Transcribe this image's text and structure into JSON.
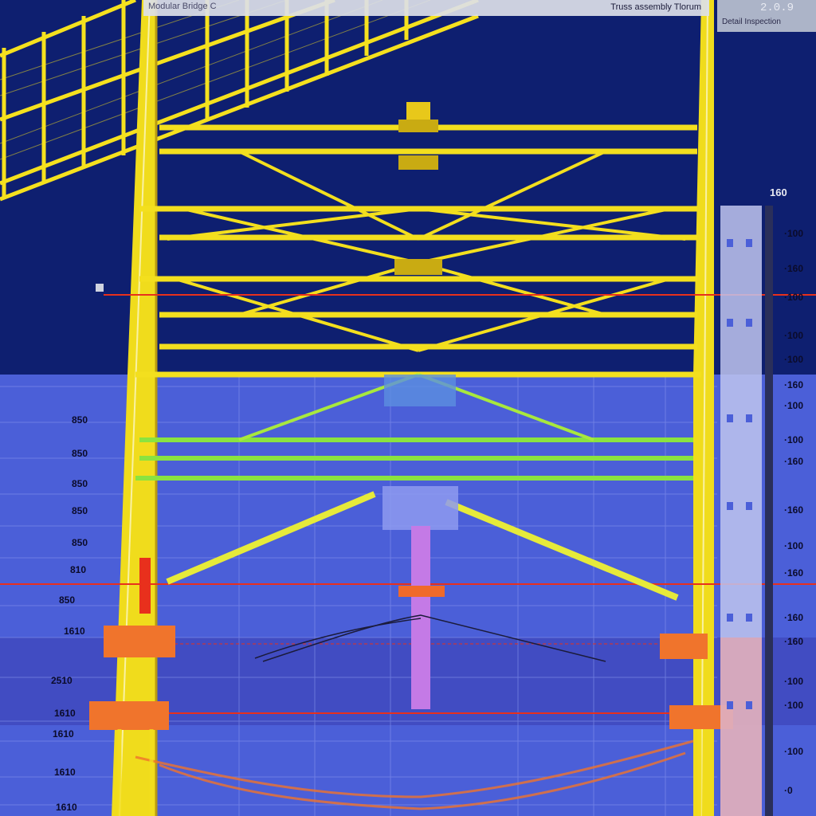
{
  "header": {
    "app_title": "Modular Bridge C",
    "view_title": "Truss assembly Tlorum",
    "version": "2.0.9",
    "subtitle": "Detail Inspection"
  },
  "scale": {
    "top_value": "160",
    "left_ticks": [
      "850",
      "850",
      "850",
      "850",
      "850",
      "810",
      "850",
      "1610",
      "2510",
      "1610",
      "1610",
      "1610",
      "1610"
    ],
    "right_ticks": [
      "100",
      "160",
      "100",
      "100",
      "100",
      "160",
      "100",
      "100",
      "160",
      "160",
      "100",
      "160",
      "160",
      "160",
      "100",
      "100",
      "100",
      "0"
    ]
  },
  "colors": {
    "sky": "#0d1f6e",
    "water": "#4b5fd8",
    "truss": "#f2e21a",
    "truss_lower": "#7de33a",
    "hazard": "#e8301c",
    "column": "#c47ae6"
  }
}
